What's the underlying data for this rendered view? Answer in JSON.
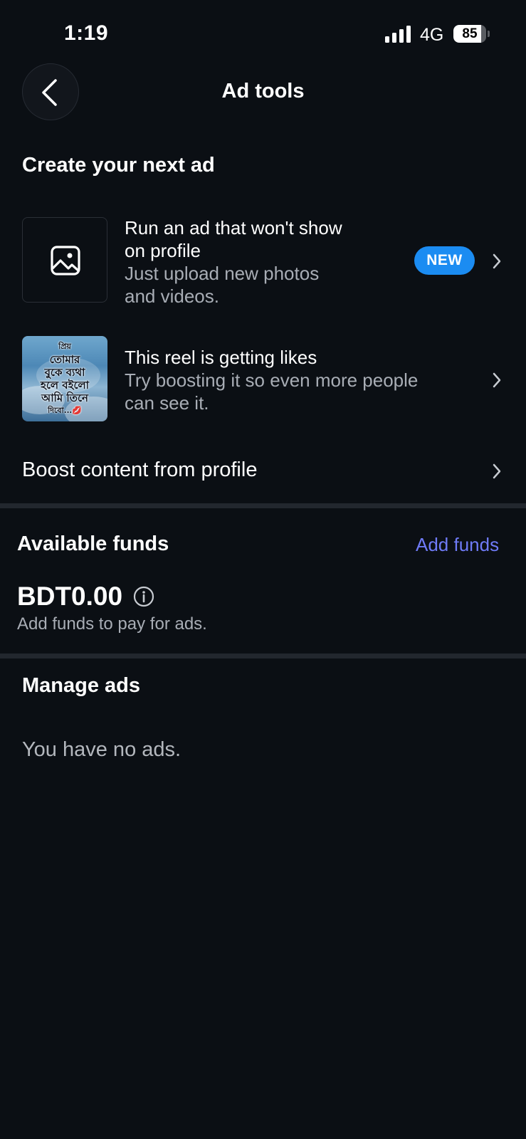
{
  "status_bar": {
    "time": "1:19",
    "network": "4G",
    "battery_level": "85",
    "battery_fraction": 0.85
  },
  "header": {
    "title": "Ad tools",
    "back_icon": "chevron-left-icon"
  },
  "create_section": {
    "heading": "Create your next ad",
    "items": [
      {
        "title": "Run an ad that won't show on profile",
        "title_lines": [
          "Run an ad that won't show",
          "on profile"
        ],
        "subtitle_lines": [
          "Just upload new photos",
          "and videos."
        ],
        "badge": "NEW",
        "icon": "image-icon"
      },
      {
        "title": "This reel is getting likes",
        "subtitle_lines": [
          "Try boosting it so even more people",
          "can see it."
        ],
        "thumbnail_text": [
          "প্রিয়",
          "তোমার",
          "বুকে ব্যথা",
          "হলে বইলো",
          "আমি তিনে",
          "দিবো...💋"
        ]
      }
    ],
    "boost_label": "Boost content from profile"
  },
  "funds": {
    "title": "Available funds",
    "add_funds_label": "Add funds",
    "amount": "BDT0.00",
    "hint": "Add funds to pay for ads."
  },
  "manage_ads": {
    "title": "Manage ads",
    "empty_text": "You have no ads."
  },
  "colors": {
    "background": "#0b0f14",
    "accent_badge": "#1b8cf2",
    "link": "#6f7bf7",
    "muted_text": "#a8adb5"
  }
}
